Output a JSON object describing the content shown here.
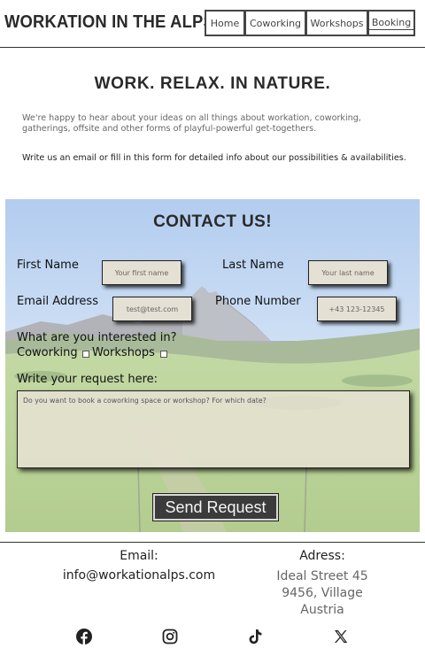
{
  "header": {
    "brand": "WORKATION IN THE ALPS",
    "nav": [
      {
        "label": "Home"
      },
      {
        "label": "Coworking"
      },
      {
        "label": "Workshops"
      },
      {
        "label": "Booking",
        "active": true
      }
    ]
  },
  "intro": {
    "headline": "WORK. RELAX. IN NATURE.",
    "paragraph1": "We're happy to hear about your ideas on all things about workation, coworking, gatherings, offsite and other forms of playful-powerful get-togethers.",
    "paragraph2": "Write us an email or fill in this form for detailed info about our possibilities & availabilities."
  },
  "contact": {
    "title": "CONTACT US!",
    "first_name_label": "First Name",
    "first_name_placeholder": "Your first name",
    "last_name_label": "Last Name",
    "last_name_placeholder": "Your last name",
    "email_label": "Email Address",
    "email_placeholder": "test@test.com",
    "phone_label": "Phone Number",
    "phone_placeholder": "+43 123-12345",
    "interest_label": "What are you interested in?",
    "option_coworking": "Coworking",
    "option_workshops": "Workshops",
    "request_label": "Write your request here:",
    "request_placeholder": "Do you want to book a coworking space or workshop? For which date?",
    "send_label": "Send Request"
  },
  "footer": {
    "email_label": "Email:",
    "email": "info@workationalps.com",
    "address_label": "Adress:",
    "address_line1": "Ideal Street 45",
    "address_line2": "9456, Village",
    "address_line3": "Austria",
    "social": [
      "facebook-icon",
      "instagram-icon",
      "tiktok-icon",
      "x-icon"
    ]
  },
  "colors": {
    "text_dark": "#2a2a2a",
    "input_bg": "#e4e0d4",
    "button_bg": "#3b3b3b"
  }
}
